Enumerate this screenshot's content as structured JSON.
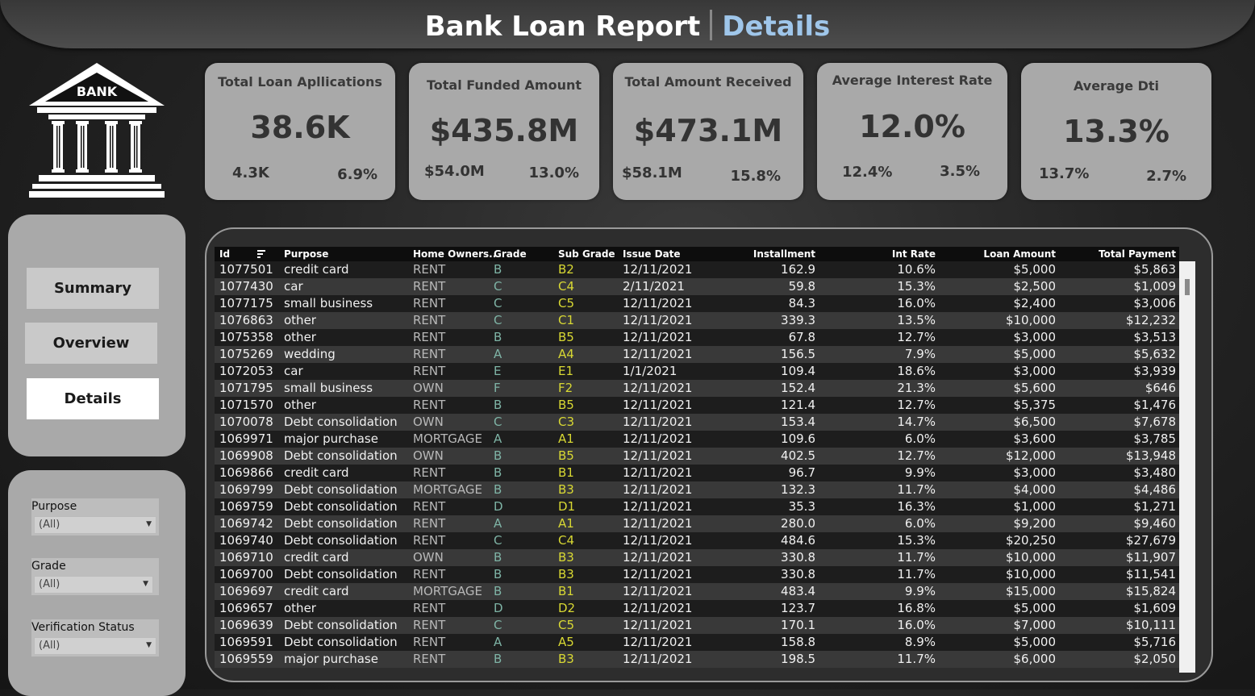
{
  "header": {
    "title": "Bank Loan Report",
    "subtitle": "Details"
  },
  "logo": {
    "text": "BANK"
  },
  "kpis": [
    {
      "label": "Total Loan Apllications",
      "value": "38.6K",
      "mtd": "4.3K",
      "mom": "6.9%"
    },
    {
      "label": "Total Funded Amount",
      "value": "$435.8M",
      "mtd": "$54.0M",
      "mom": "13.0%"
    },
    {
      "label": "Total Amount Received",
      "value": "$473.1M",
      "mtd": "$58.1M",
      "mom": "15.8%"
    },
    {
      "label": "Average Interest Rate",
      "value": "12.0%",
      "mtd": "12.4%",
      "mom": "3.5%"
    },
    {
      "label": "Average Dti",
      "value": "13.3%",
      "mtd": "13.7%",
      "mom": "2.7%"
    }
  ],
  "nav": {
    "summary": "Summary",
    "overview": "Overview",
    "details": "Details"
  },
  "filters": [
    {
      "label": "Purpose",
      "value": "(All)"
    },
    {
      "label": "Grade",
      "value": "(All)"
    },
    {
      "label": "Verification Status",
      "value": "(All)"
    }
  ],
  "table": {
    "columns": [
      "Id",
      "Purpose",
      "Home Owners..",
      "Grade",
      "Sub Grade",
      "Issue Date",
      "Installment",
      "Int Rate",
      "Loan Amount",
      "Total Payment"
    ],
    "rows": [
      [
        "1077501",
        "credit card",
        "RENT",
        "B",
        "B2",
        "12/11/2021",
        "162.9",
        "10.6%",
        "$5,000",
        "$5,863"
      ],
      [
        "1077430",
        "car",
        "RENT",
        "C",
        "C4",
        "2/11/2021",
        "59.8",
        "15.3%",
        "$2,500",
        "$1,009"
      ],
      [
        "1077175",
        "small business",
        "RENT",
        "C",
        "C5",
        "12/11/2021",
        "84.3",
        "16.0%",
        "$2,400",
        "$3,006"
      ],
      [
        "1076863",
        "other",
        "RENT",
        "C",
        "C1",
        "12/11/2021",
        "339.3",
        "13.5%",
        "$10,000",
        "$12,232"
      ],
      [
        "1075358",
        "other",
        "RENT",
        "B",
        "B5",
        "12/11/2021",
        "67.8",
        "12.7%",
        "$3,000",
        "$3,513"
      ],
      [
        "1075269",
        "wedding",
        "RENT",
        "A",
        "A4",
        "12/11/2021",
        "156.5",
        "7.9%",
        "$5,000",
        "$5,632"
      ],
      [
        "1072053",
        "car",
        "RENT",
        "E",
        "E1",
        "1/1/2021",
        "109.4",
        "18.6%",
        "$3,000",
        "$3,939"
      ],
      [
        "1071795",
        "small business",
        "OWN",
        "F",
        "F2",
        "12/11/2021",
        "152.4",
        "21.3%",
        "$5,600",
        "$646"
      ],
      [
        "1071570",
        "other",
        "RENT",
        "B",
        "B5",
        "12/11/2021",
        "121.4",
        "12.7%",
        "$5,375",
        "$1,476"
      ],
      [
        "1070078",
        "Debt consolidation",
        "OWN",
        "C",
        "C3",
        "12/11/2021",
        "153.4",
        "14.7%",
        "$6,500",
        "$7,678"
      ],
      [
        "1069971",
        "major purchase",
        "MORTGAGE",
        "A",
        "A1",
        "12/11/2021",
        "109.6",
        "6.0%",
        "$3,600",
        "$3,785"
      ],
      [
        "1069908",
        "Debt consolidation",
        "OWN",
        "B",
        "B5",
        "12/11/2021",
        "402.5",
        "12.7%",
        "$12,000",
        "$13,948"
      ],
      [
        "1069866",
        "credit card",
        "RENT",
        "B",
        "B1",
        "12/11/2021",
        "96.7",
        "9.9%",
        "$3,000",
        "$3,480"
      ],
      [
        "1069799",
        "Debt consolidation",
        "MORTGAGE",
        "B",
        "B3",
        "12/11/2021",
        "132.3",
        "11.7%",
        "$4,000",
        "$4,486"
      ],
      [
        "1069759",
        "Debt consolidation",
        "RENT",
        "D",
        "D1",
        "12/11/2021",
        "35.3",
        "16.3%",
        "$1,000",
        "$1,271"
      ],
      [
        "1069742",
        "Debt consolidation",
        "RENT",
        "A",
        "A1",
        "12/11/2021",
        "280.0",
        "6.0%",
        "$9,200",
        "$9,460"
      ],
      [
        "1069740",
        "Debt consolidation",
        "RENT",
        "C",
        "C4",
        "12/11/2021",
        "484.6",
        "15.3%",
        "$20,250",
        "$27,679"
      ],
      [
        "1069710",
        "credit card",
        "OWN",
        "B",
        "B3",
        "12/11/2021",
        "330.8",
        "11.7%",
        "$10,000",
        "$11,907"
      ],
      [
        "1069700",
        "Debt consolidation",
        "RENT",
        "B",
        "B3",
        "12/11/2021",
        "330.8",
        "11.7%",
        "$10,000",
        "$11,541"
      ],
      [
        "1069697",
        "credit card",
        "MORTGAGE",
        "B",
        "B1",
        "12/11/2021",
        "483.4",
        "9.9%",
        "$15,000",
        "$15,824"
      ],
      [
        "1069657",
        "other",
        "RENT",
        "D",
        "D2",
        "12/11/2021",
        "123.7",
        "16.8%",
        "$5,000",
        "$1,609"
      ],
      [
        "1069639",
        "Debt consolidation",
        "RENT",
        "C",
        "C5",
        "12/11/2021",
        "170.1",
        "16.0%",
        "$7,000",
        "$10,111"
      ],
      [
        "1069591",
        "Debt consolidation",
        "RENT",
        "A",
        "A5",
        "12/11/2021",
        "158.8",
        "8.9%",
        "$5,000",
        "$5,716"
      ],
      [
        "1069559",
        "major purchase",
        "RENT",
        "B",
        "B3",
        "12/11/2021",
        "198.5",
        "11.7%",
        "$6,000",
        "$2,050"
      ]
    ]
  }
}
